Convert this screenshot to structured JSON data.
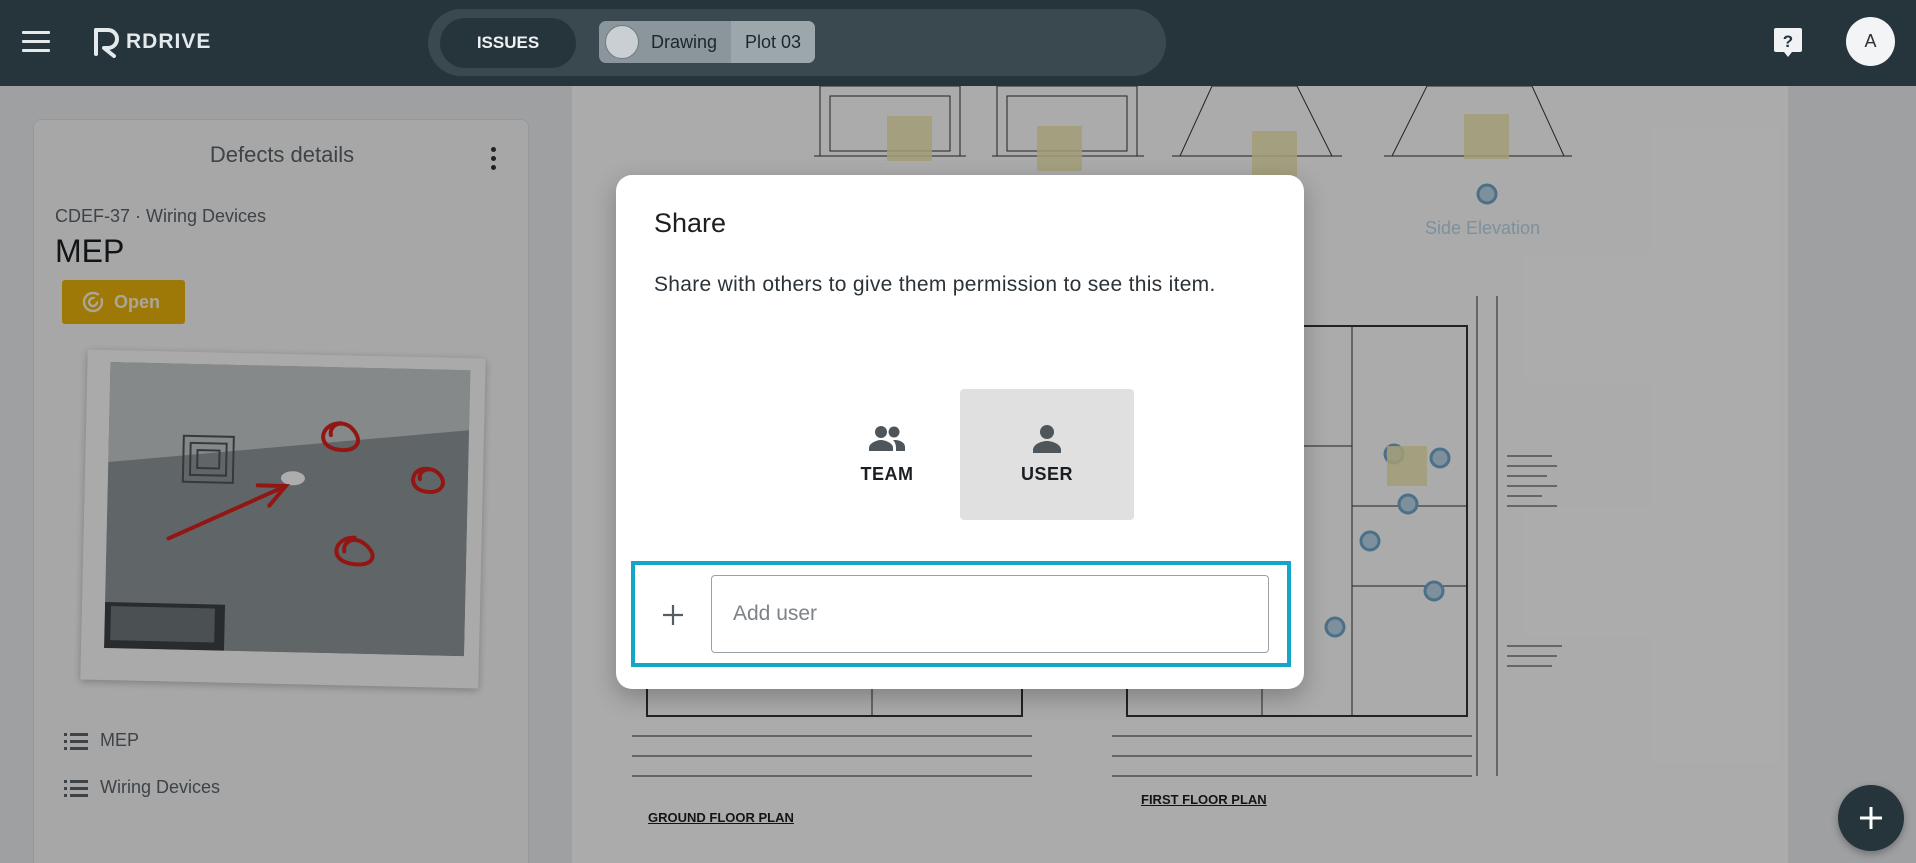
{
  "header": {
    "brand": "RDRIVE",
    "nav_button": "ISSUES",
    "breadcrumbs": [
      "Drawing",
      "Plot 03"
    ],
    "avatar_initial": "A",
    "icons": [
      "menu-icon",
      "help-icon"
    ]
  },
  "defect": {
    "panel_title": "Defects details",
    "code": "CDEF-37 · Wiring Devices",
    "title": "MEP",
    "status": "Open",
    "tags": [
      "MEP",
      "Wiring Devices"
    ]
  },
  "drawing": {
    "labels": {
      "ground_floor": "GROUND FLOOR PLAN",
      "first_floor": "FIRST FLOOR PLAN",
      "side_elevation": "Side Elevation"
    }
  },
  "dialog": {
    "title": "Share",
    "description": "Share with others to give them permission to see this item.",
    "options": [
      {
        "label": "TEAM",
        "icon": "group-icon",
        "selected": false
      },
      {
        "label": "USER",
        "icon": "person-icon",
        "selected": true
      }
    ],
    "add_user_placeholder": "Add user"
  },
  "colors": {
    "topbar": "#26343c",
    "status": "#e9b30c",
    "focus_border": "#13a6c9"
  }
}
